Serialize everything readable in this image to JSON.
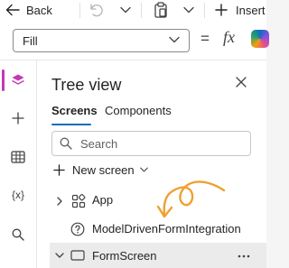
{
  "toolbar": {
    "back_label": "Back",
    "insert_label": "Insert"
  },
  "formula_bar": {
    "property_value": "Fill",
    "equals": "=",
    "fx": "fx"
  },
  "rail": {
    "variables_label": "{x}",
    "active_color": "#c239b3"
  },
  "panel": {
    "title": "Tree view",
    "tabs": [
      {
        "label": "Screens",
        "selected": true
      },
      {
        "label": "Components",
        "selected": false
      }
    ],
    "search": {
      "placeholder": "Search"
    },
    "new_screen_label": "New screen",
    "tree": [
      {
        "label": "App",
        "icon": "app-icon",
        "expandable": true
      },
      {
        "label": "ModelDrivenFormIntegration",
        "icon": "help-circle-icon",
        "expandable": false
      },
      {
        "label": "FormScreen",
        "icon": "screen-icon",
        "expandable": true,
        "expanded": true,
        "selected": true
      }
    ]
  },
  "annotation": {
    "color": "#f0a030"
  },
  "colors": {
    "accent": "#0f6cbd"
  }
}
